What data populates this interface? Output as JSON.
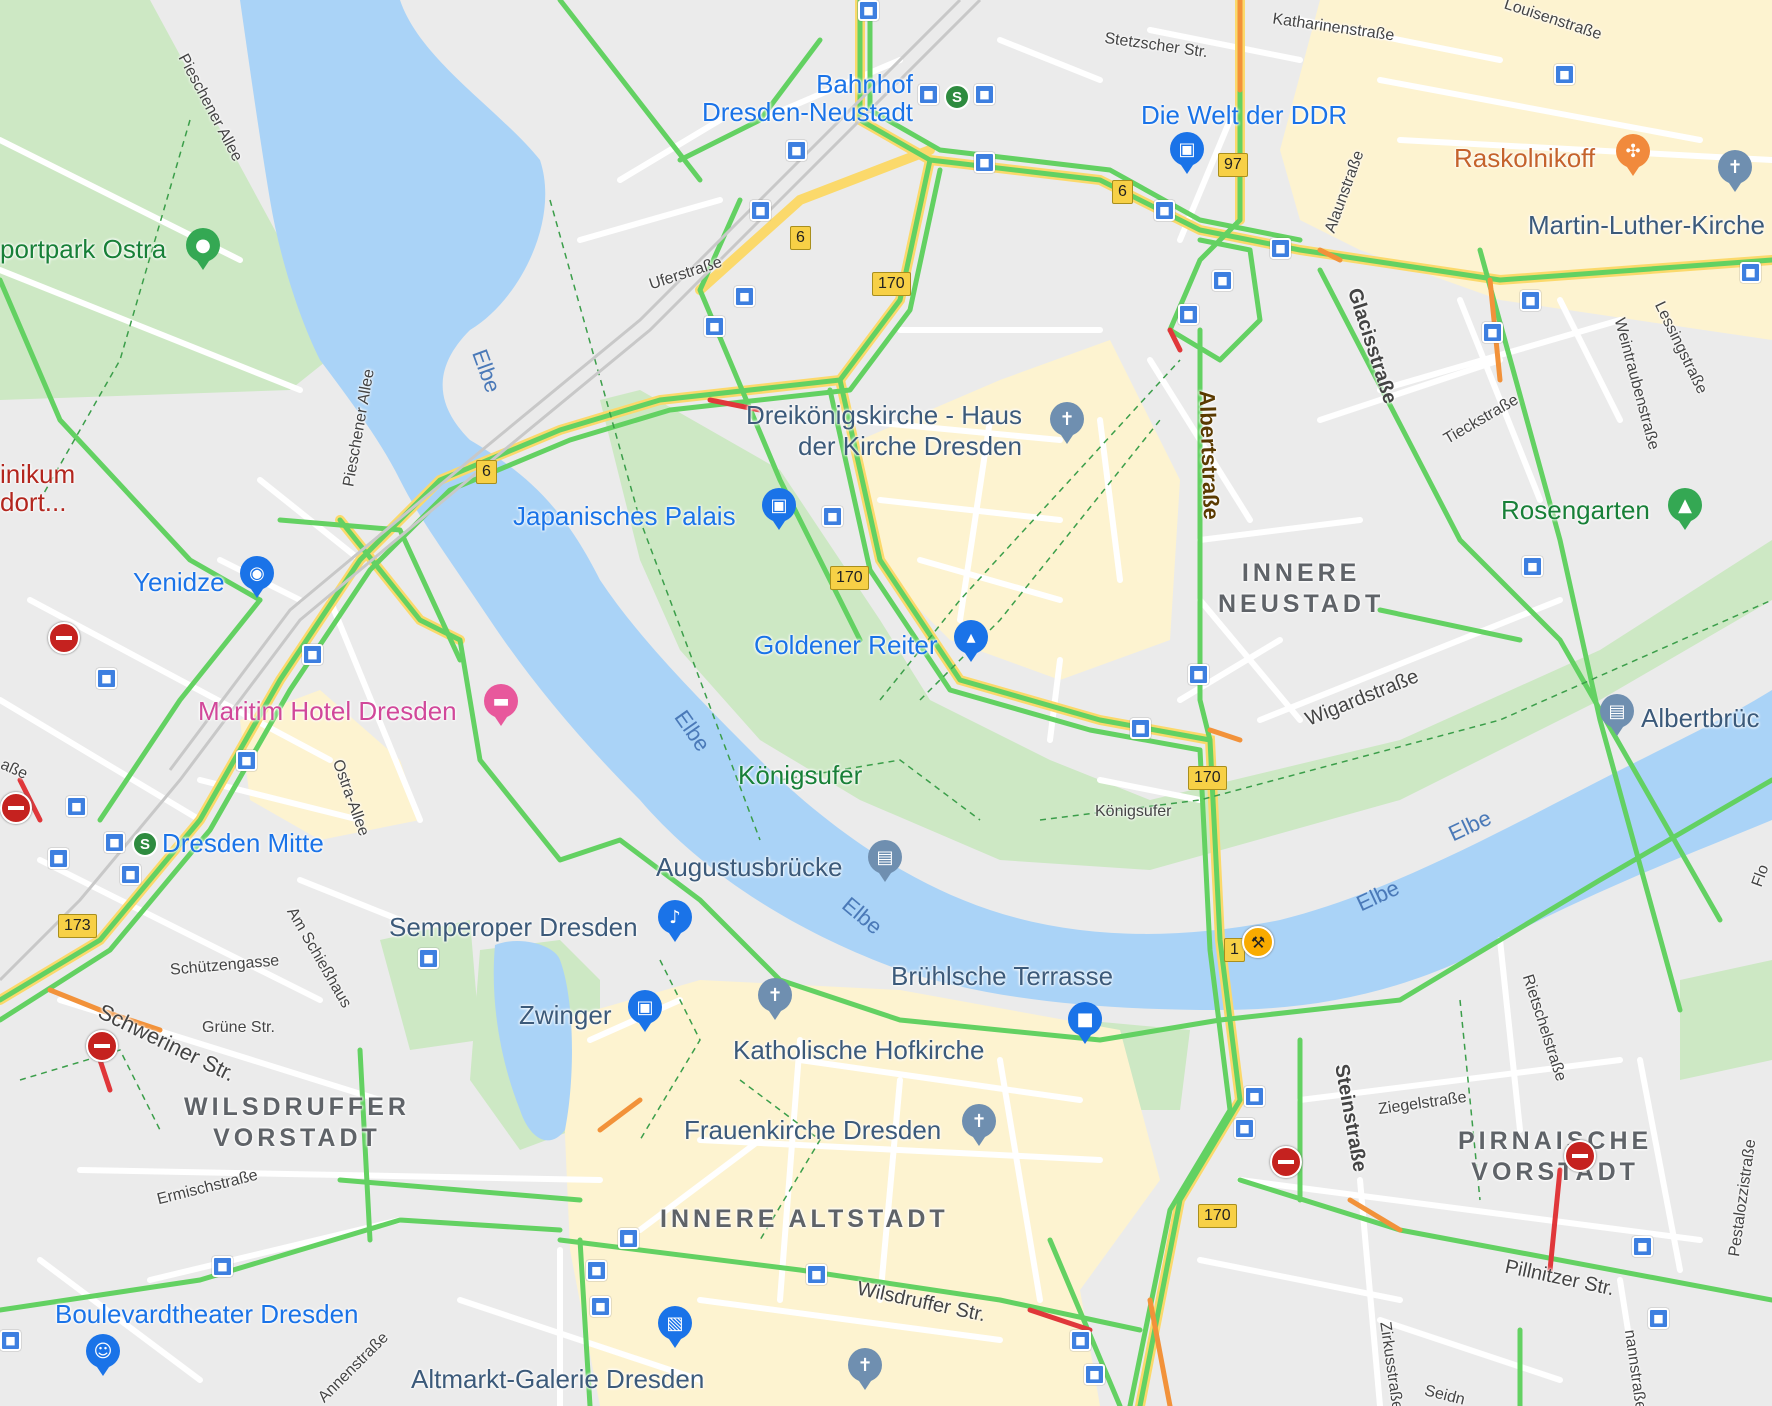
{
  "map": {
    "rivers": [
      "Elbe",
      "Elbe",
      "Elbe",
      "Elbe",
      "Elbe"
    ],
    "districts": {
      "innere_neustadt": [
        "INNERE",
        "NEUSTADT"
      ],
      "wilsdruffer_vorstadt": [
        "WILSDRUFFER",
        "VORSTADT"
      ],
      "innere_altstadt": "INNERE ALTSTADT",
      "pirnaische_vorstadt": [
        "PIRNAISCHE",
        "VORSTADT"
      ]
    },
    "pois": {
      "bahnhof": [
        "Bahnhof",
        "Dresden-Neustadt"
      ],
      "welt_ddr": "Die Welt der DDR",
      "raskolnikoff": "Raskolnikoff",
      "martin_luther": "Martin-Luther-Kirche",
      "sportpark": "portpark Ostra",
      "klinikum": [
        "inikum",
        "dort..."
      ],
      "dreikoenig": [
        "Dreikönigskirche - Haus",
        "der Kirche Dresden"
      ],
      "japanisches": "Japanisches Palais",
      "yenidze": "Yenidze",
      "rosengarten": "Rosengarten",
      "goldener_reiter": "Goldener Reiter",
      "maritim": "Maritim Hotel Dresden",
      "koenigsufer_park": "Königsufer",
      "albertbruecke": "Albertbrüc",
      "dresden_mitte": "Dresden Mitte",
      "augustusbruecke": "Augustusbrücke",
      "semperoper": "Semperoper Dresden",
      "bruehlsche": "Brühlsche Terrasse",
      "zwinger": "Zwinger",
      "hofkirche": "Katholische Hofkirche",
      "frauenkirche": "Frauenkirche Dresden",
      "boulevardtheater": "Boulevardtheater Dresden",
      "altmarkt": "Altmarkt-Galerie Dresden"
    },
    "streets": {
      "stetzscher": "Stetzscher Str.",
      "katharinen": "Katharinenstraße",
      "louisen": "Louisenstraße",
      "pieschener_allee_1": "Pieschener Allee",
      "pieschener_allee_2": "Pieschener Allee",
      "uferstrasse": "Uferstraße",
      "alaunstrasse": "Alaunstraße",
      "glacisstrasse": "Glacisstraße",
      "albertstrasse": "Albertstraße",
      "weintrauben": "Weintraubenstraße",
      "lessing": "Lessingstraße",
      "tieck": "Tieckstraße",
      "wigard": "Wigardstraße",
      "koenigsufer_str": "Königsufer",
      "ostra_allee": "Ostra-Allee",
      "am_schiesshaus": "Am Schießhaus",
      "schuetzengasse": "Schützengasse",
      "schweriner": "Schweriner Str.",
      "gruene": "Grüne Str.",
      "ermisch": "Ermischstraße",
      "steinstrasse": "Steinstraße",
      "ziegel": "Ziegelstraße",
      "rietschel": "Rietschelstraße",
      "pestalozzi": "Pestalozzistraße",
      "pillnitzer": "Pillnitzer Str.",
      "wilsdruffer": "Wilsdruffer Str.",
      "annen": "Annenstraße",
      "zirkus": "Zirkusstraße",
      "ostra_frag": "aße",
      "flo_frag": "Flo",
      "seid_frag": "Seidn",
      "mann_frag": "nannstraße"
    },
    "route_shields": [
      "97",
      "6",
      "6",
      "170",
      "6",
      "170",
      "170",
      "170",
      "173",
      "1",
      "170"
    ],
    "colors": {
      "water": "#aad3f7",
      "park": "#cde8c4",
      "land": "#ebebeb",
      "road": "#ffffff",
      "traffic_fast": "#63d162",
      "traffic_slow": "#f2923a",
      "traffic_jam": "#e0373a",
      "highlight_area": "#fdf3d0",
      "major_road": "#fbd96b"
    },
    "icons": {
      "museum": "museum-icon",
      "restaurant": "restaurant-icon",
      "church": "church-icon",
      "park": "park-pin-icon",
      "camera": "camera-icon",
      "hotel": "hotel-icon",
      "tree": "tree-icon",
      "monument": "monument-icon",
      "bridge": "bridge-icon",
      "music": "music-icon",
      "viewpoint": "viewpoint-icon",
      "theater": "theater-icon",
      "shopping": "shopping-icon",
      "tram": "tram-stop-icon",
      "sbahn": "s-bahn-icon",
      "no_entry": "no-entry-icon",
      "roadwork": "roadwork-icon"
    }
  }
}
